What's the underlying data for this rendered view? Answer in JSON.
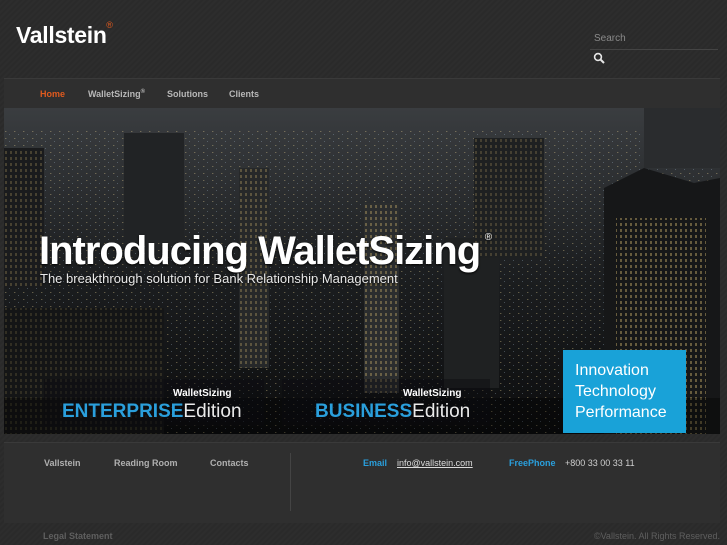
{
  "brand": {
    "logo": "Vallstein",
    "logo_reg": "®"
  },
  "search": {
    "placeholder": "Search",
    "icon": "search-icon"
  },
  "nav": {
    "items": [
      {
        "label": "Home",
        "active": true
      },
      {
        "label": "WalletSizing",
        "sup": "®",
        "active": false
      },
      {
        "label": "Solutions",
        "active": false
      },
      {
        "label": "Clients",
        "active": false
      }
    ]
  },
  "hero": {
    "title": "Introducing WalletSizing",
    "title_reg": "®",
    "subtitle": "The breakthrough solution for Bank Relationship Management",
    "editions": [
      {
        "brand": "WalletSizing",
        "kind": "ENTERPRISE",
        "edition": "Edition"
      },
      {
        "brand": "WalletSizing",
        "kind": "BUSINESS",
        "edition": "Edition"
      }
    ],
    "tagline": [
      "Innovation",
      "Technology",
      "Performance"
    ],
    "tagline_color": "#19a2d8"
  },
  "footer": {
    "links": [
      "Vallstein",
      "Reading Room",
      "Contacts"
    ],
    "email_label": "Email",
    "email_value": "info@vallstein.com",
    "phone_label": "FreePhone",
    "phone_value": "+800 33 00 33 11",
    "legal": "Legal Statement",
    "copyright": "©Vallstein. All Rights Reserved."
  },
  "colors": {
    "accent": "#e05a1e",
    "link_blue": "#2a9fdc",
    "background": "#2b2b2b"
  }
}
